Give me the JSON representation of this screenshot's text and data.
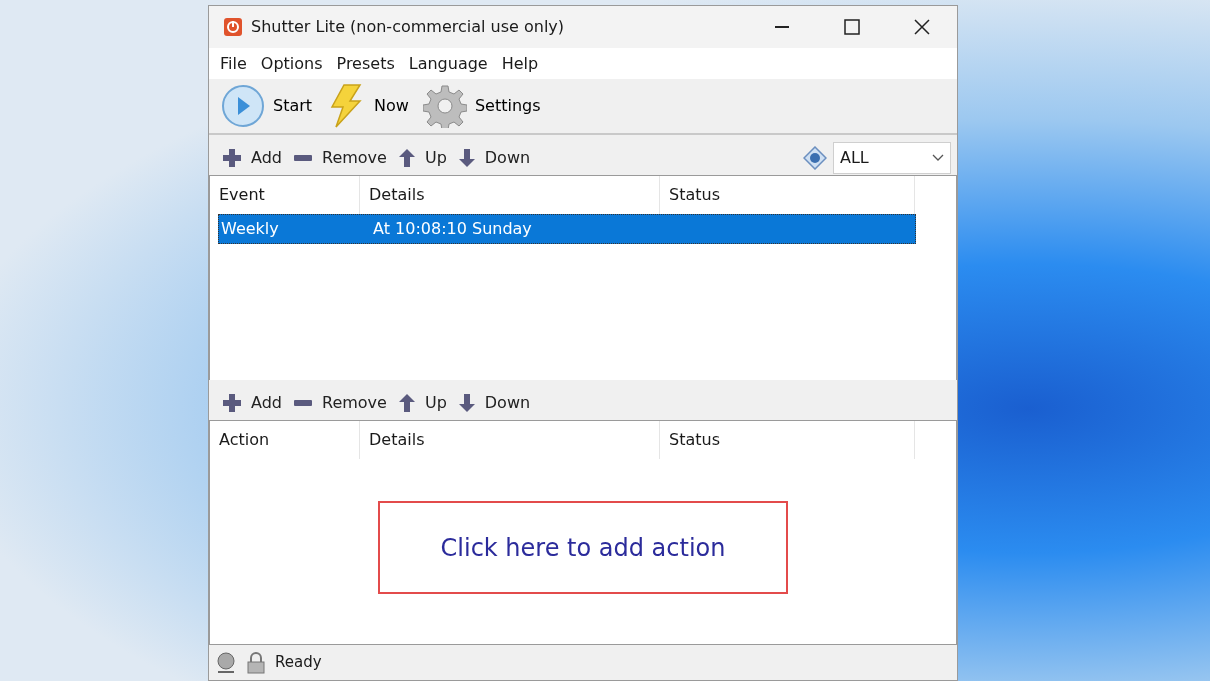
{
  "window": {
    "title": "Shutter Lite (non-commercial use only)"
  },
  "menu": [
    "File",
    "Options",
    "Presets",
    "Language",
    "Help"
  ],
  "toolbar": [
    {
      "kind": "start",
      "label": "Start"
    },
    {
      "kind": "now",
      "label": "Now"
    },
    {
      "kind": "settings",
      "label": "Settings"
    }
  ],
  "events": {
    "toolbar": [
      {
        "kind": "add",
        "label": "Add"
      },
      {
        "kind": "remove",
        "label": "Remove"
      },
      {
        "kind": "up",
        "label": "Up"
      },
      {
        "kind": "down",
        "label": "Down"
      }
    ],
    "filter": {
      "value": "ALL"
    },
    "columns": [
      "Event",
      "Details",
      "Status"
    ],
    "rows": [
      {
        "event": "Weekly",
        "details": "At 10:08:10 Sunday",
        "selected": true
      }
    ]
  },
  "actions": {
    "toolbar": [
      {
        "kind": "add",
        "label": "Add"
      },
      {
        "kind": "remove",
        "label": "Remove"
      },
      {
        "kind": "up",
        "label": "Up"
      },
      {
        "kind": "down",
        "label": "Down"
      }
    ],
    "columns": [
      "Action",
      "Details",
      "Status"
    ],
    "hint": "Click here to add action"
  },
  "status_bar": {
    "text": "Ready"
  }
}
